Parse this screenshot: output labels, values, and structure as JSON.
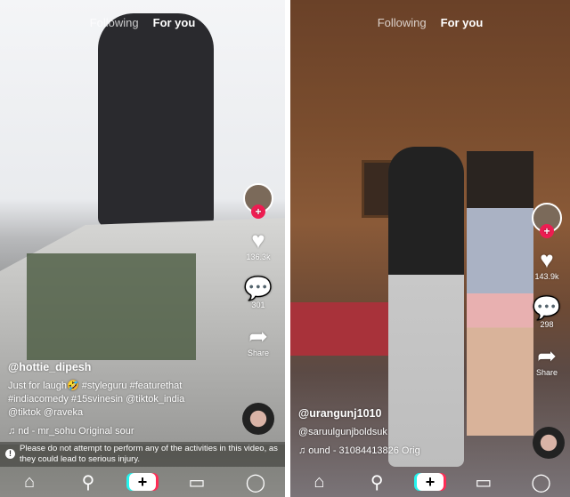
{
  "feeds": [
    {
      "tabs": {
        "following": "Following",
        "for_you": "For you"
      },
      "likes": "136.3k",
      "comments": "301",
      "share": "Share",
      "username": "@hottie_dipesh",
      "caption_lines": [
        "Just for laugh🤣 #styleguru #featurethat",
        "#indiacomedy #15svinesin @tiktok_india",
        "@tiktok @raveka"
      ],
      "music": "♫  nd - mr_sohu    Original sour",
      "warning": "Please do not attempt to perform any of the activities in this video, as they could lead to serious injury.",
      "nav_icons": [
        "home-icon",
        "search-icon",
        "create-icon",
        "inbox-icon",
        "profile-icon"
      ]
    },
    {
      "tabs": {
        "following": "Following",
        "for_you": "For you"
      },
      "likes": "143.9k",
      "comments": "298",
      "share": "Share",
      "username": "@urangunj1010",
      "caption_lines": [
        "@saruulgunjboldsuk"
      ],
      "music": "♫  ound - 31084413826    Orig",
      "nav_icons": [
        "home-icon",
        "search-icon",
        "create-icon",
        "inbox-icon",
        "profile-icon"
      ]
    }
  ],
  "colors": {
    "accent_red": "#ee1d52",
    "accent_cyan": "#25f4ee"
  }
}
